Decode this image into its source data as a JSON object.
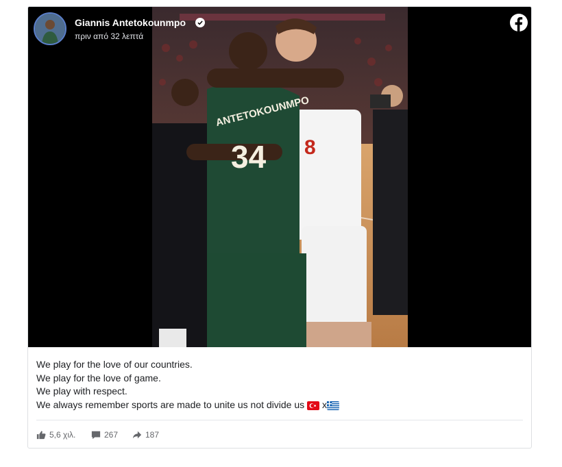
{
  "post": {
    "author": "Giannis Antetokounmpo",
    "time": "πριν από 32 λεπτά",
    "lines": [
      "We play for the love of our countries.",
      "We play for the love of game.",
      "We play with respect.",
      "We always remember sports are made to unite us not divide us"
    ],
    "separator": "x",
    "stats": {
      "likes": "5,6 χιλ.",
      "comments": "267",
      "shares": "187"
    },
    "jersey_name": "ANTETOKOUNMPO",
    "jersey_number": "34"
  },
  "icons": [
    "verified-badge-icon",
    "facebook-logo-icon",
    "like-icon",
    "comment-icon",
    "share-icon",
    "turkey-flag-icon",
    "greece-flag-icon"
  ],
  "colors": {
    "bucks_green": "#1f4a34",
    "court": "#c98d56",
    "red_paint": "#c4281c",
    "text": "#1c1e21",
    "muted": "#65676b"
  }
}
